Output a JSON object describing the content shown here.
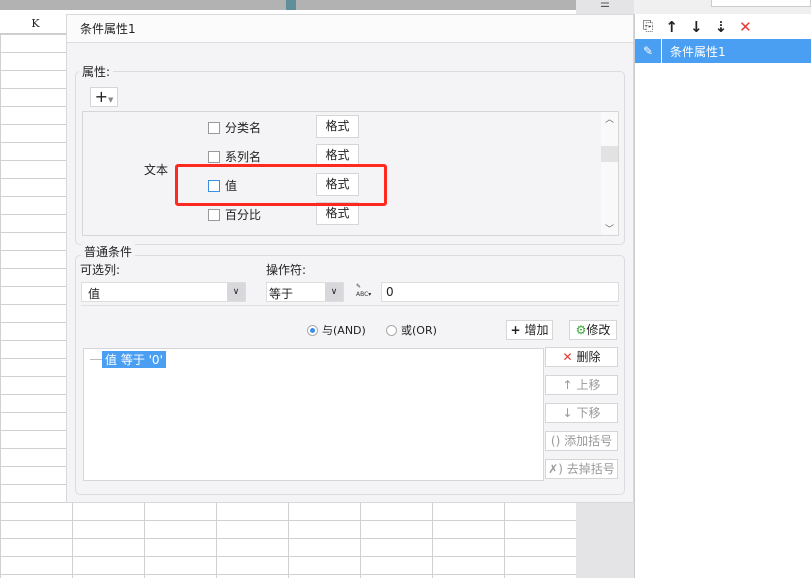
{
  "spreadsheet": {
    "column_header": "K"
  },
  "right_panel": {
    "toolbar_icons": [
      "copy-icon",
      "arrow-up-icon",
      "arrow-down-icon",
      "move-bottom-icon",
      "delete-icon"
    ],
    "items": [
      {
        "label": "条件属性1",
        "selected": true
      }
    ],
    "accent": "#4b9ff2"
  },
  "dialog": {
    "title": "条件属性1",
    "attributes": {
      "legend": "属性:",
      "add_icon": "plus-icon",
      "group_label": "文本",
      "items": [
        {
          "label": "分类名",
          "checked": false,
          "format_label": "格式"
        },
        {
          "label": "系列名",
          "checked": false,
          "format_label": "格式"
        },
        {
          "label": "值",
          "checked": false,
          "format_label": "格式",
          "highlighted": true
        },
        {
          "label": "百分比",
          "checked": false,
          "format_label": "格式"
        }
      ],
      "highlight_color": "#ff2a1f"
    },
    "conditions": {
      "legend": "普通条件",
      "column_label": "可选列:",
      "column_value": "值",
      "operator_label": "操作符:",
      "operator_value": "等于",
      "value": "0",
      "and_label": "与(AND)",
      "or_label": "或(OR)",
      "and_selected": true,
      "add_label": "增加",
      "modify_label": "修改",
      "list_items": [
        "值 等于 '0'"
      ],
      "delete_label": "删除",
      "up_label": "上移",
      "down_label": "下移",
      "add_paren_label": "添加括号",
      "remove_paren_label": "去掉括号"
    }
  }
}
